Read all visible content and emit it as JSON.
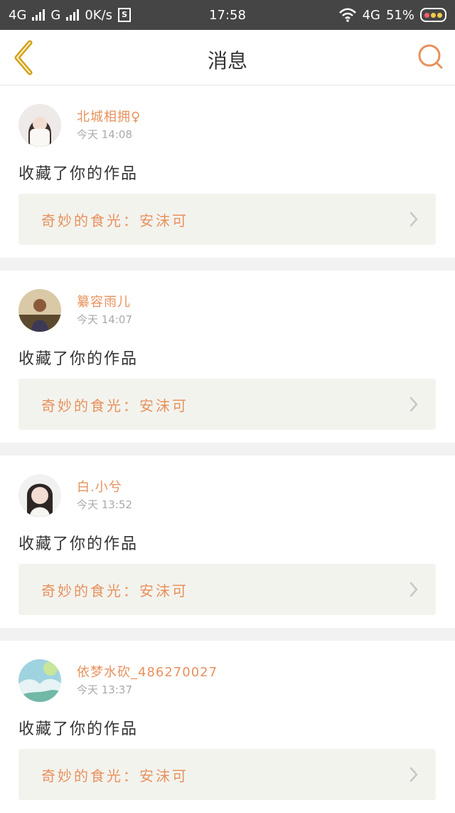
{
  "status_bar": {
    "network1": "4G",
    "network2": "G",
    "speed": "0K/s",
    "s_badge": "S",
    "time": "17:58",
    "network3": "4G",
    "battery_percent": "51%"
  },
  "header": {
    "title": "消息"
  },
  "messages": [
    {
      "username": "北城相拥♀",
      "time": "今天 14:08",
      "action": "收藏了你的作品",
      "work": "奇妙的食光：安沫可"
    },
    {
      "username": "纂容雨儿",
      "time": "今天 14:07",
      "action": "收藏了你的作品",
      "work": "奇妙的食光：安沫可"
    },
    {
      "username": "白.小兮",
      "time": "今天 13:52",
      "action": "收藏了你的作品",
      "work": "奇妙的食光：安沫可"
    },
    {
      "username": "依梦水砍_486270027",
      "time": "今天 13:37",
      "action": "收藏了你的作品",
      "work": "奇妙的食光：安沫可"
    }
  ],
  "colors": {
    "accent": "#e7915d",
    "status_bar": "#454545",
    "back_icon": "#d4a11e"
  }
}
